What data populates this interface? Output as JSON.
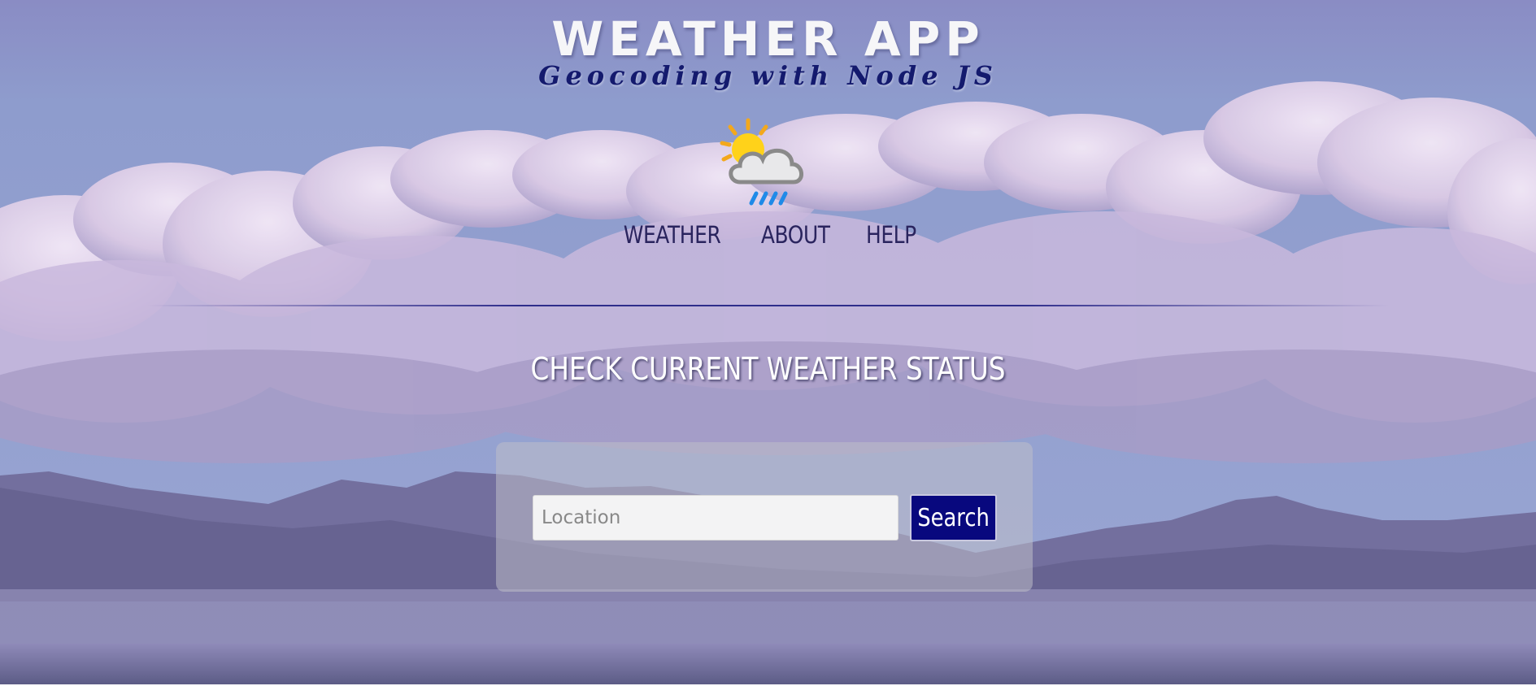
{
  "header": {
    "title": "WEATHER APP",
    "subtitle": "Geocoding with Node JS",
    "logo_icon": "sun-cloud-rain-icon"
  },
  "nav": {
    "items": [
      {
        "label": "WEATHER"
      },
      {
        "label": "ABOUT"
      },
      {
        "label": "HELP"
      }
    ]
  },
  "main": {
    "heading": "CHECK CURRENT WEATHER STATUS"
  },
  "search": {
    "placeholder": "Location",
    "value": "",
    "button_label": "Search"
  },
  "colors": {
    "accent": "#08087e",
    "title": "#f6f6f8",
    "subtitle": "#141a6e",
    "nav_text": "#2a245e"
  }
}
